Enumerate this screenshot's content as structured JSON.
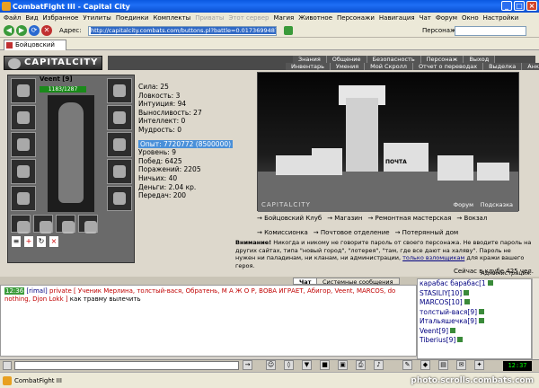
{
  "window": {
    "title": "CombatFight III - Capital City",
    "minimize": "_",
    "maximize": "□",
    "close": "×"
  },
  "menu": [
    "Файл",
    "Вид",
    "Избранное",
    "Утилиты",
    "Поединки",
    "Комплекты",
    "Приваты",
    "Этот сервер",
    "Магия",
    "Животное",
    "Персонажи",
    "Навигация",
    "Чат",
    "Форум",
    "Окно",
    "Настройки"
  ],
  "menu_disabled": [
    6,
    7
  ],
  "toolbar": {
    "address_label": "Адрес:",
    "address": "http://capitalcity.combats.com/buttons.pl?battle=0.0173699487790685",
    "person_label": "Персонаж:"
  },
  "tab": {
    "label": "Бойцовский клуб"
  },
  "game": {
    "logo": "CAPITALCITY",
    "nav_top": [
      "Знания",
      "Общение",
      "Безопасность",
      "Персонаж",
      "Выход"
    ],
    "nav_bottom": [
      "Инвентарь",
      "Умения",
      "Мой Скролл",
      "Отчет о переводах",
      "Выделка",
      "Анкета"
    ],
    "character": {
      "name": "Veent [9]",
      "hp": "1183/1287"
    },
    "stats": {
      "strength": "Сила: 25",
      "agility": "Ловкость: 3",
      "intuition": "Интуиция: 94",
      "endurance": "Выносливость: 27",
      "intellect": "Интеллект: 0",
      "wisdom": "Мудрость: 0",
      "experience": "Опыт: 7720772 (8500000)",
      "level": "Уровень: 9",
      "wins": "Побед: 6425",
      "losses": "Поражений: 2205",
      "draws": "Ничьих: 40",
      "money": "Деньги: 2.04 кр.",
      "transfers": "Передач: 200"
    },
    "scene": {
      "brand": "CAPITALCITY",
      "forum": "Форум",
      "hint": "Подсказка",
      "sign": "ПОЧТА"
    },
    "locations": [
      "Бойцовский Клуб",
      "Магазин",
      "Ремонтная мастерская",
      "Вокзал",
      "Комиссионка",
      "Почтовое отделение",
      "Потерянный дом"
    ],
    "warning": {
      "bold": "Внимание!",
      "text1": " Никогда и никому не говорите пароль от своего персонажа. Не вводите пароль на других сайтах, типа \"новый город\", \"лотерея\", \"там, где все дают на халяву\". Пароль не нужен ни паладинам, ни кланам, ни администрации, ",
      "link": "только взломщикам",
      "text2": " для кражи вашего героя.",
      "signature": "Администрация."
    },
    "online": "Сейчас в клубе 425 чел."
  },
  "chat": {
    "tabs": [
      "Чат",
      "Системные сообщения"
    ],
    "time": "12:36",
    "sender": "[rimal]",
    "private_label": "private [ Ученик Мерлина, толстый-вася, Обратень, М А Ж О Р, ВОВА ИГРАЕТ, Абигор, Veent, MARCOS, do nothing, Djon Lokk ]",
    "message": " как травму вылечить"
  },
  "userlist": [
    "карабас барабас[1",
    "STASILIY[10]",
    "MARCOS[10]",
    "толстый-вася[9]",
    "Итальяшечка[9]",
    "Veent[9]",
    "Tiberius[9]"
  ],
  "clock": "12:37",
  "status": {
    "text": "CombatFight III",
    "watermark": "photo.scrolls.combats.com"
  }
}
